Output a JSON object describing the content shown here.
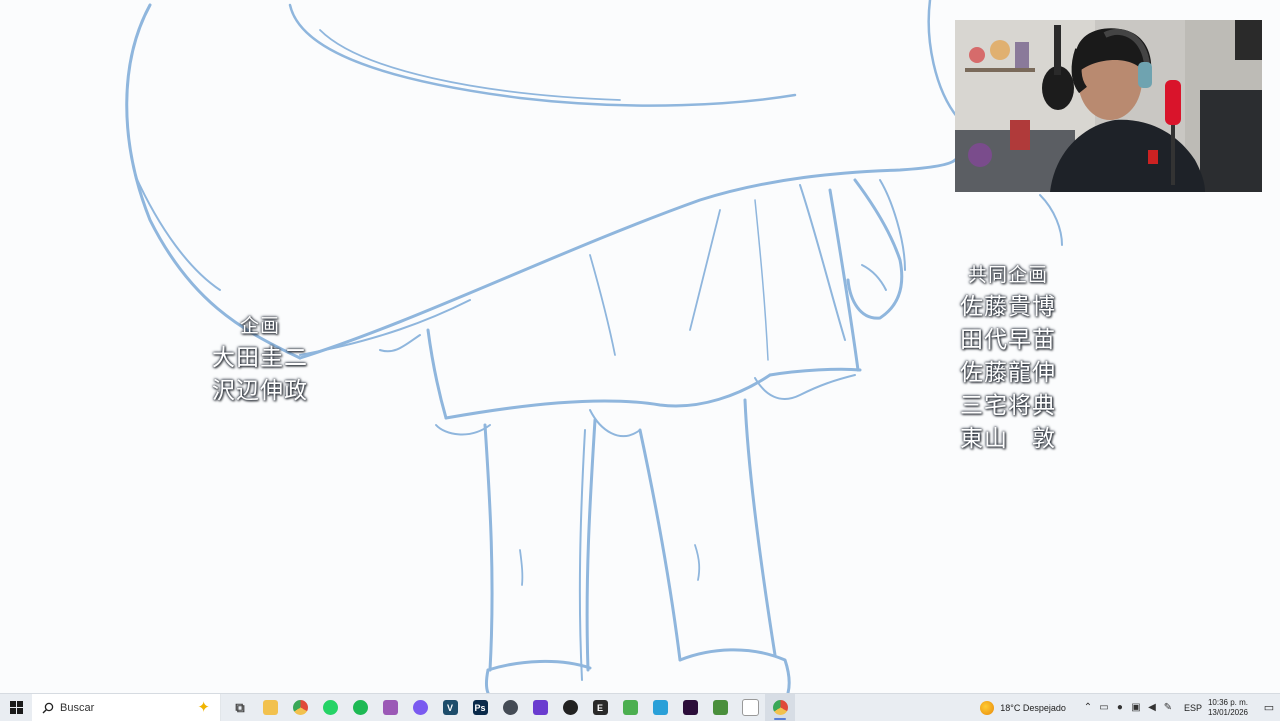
{
  "credits": {
    "left": {
      "heading": "企画",
      "names": [
        "大田圭二",
        "沢辺伸政"
      ]
    },
    "right": {
      "heading": "共同企画",
      "names": [
        "佐藤貴博",
        "田代早苗",
        "佐藤龍伸",
        "三宅将典",
        "東山　敦"
      ]
    }
  },
  "colors": {
    "sketch_line": "#8fb6dd",
    "background": "#fbfcfd",
    "taskbar": "#e9edf2"
  },
  "taskbar": {
    "search_placeholder": "Buscar",
    "apps": [
      {
        "name": "task-view-icon",
        "glyph": "⧉",
        "color": "#444444"
      },
      {
        "name": "file-explorer-icon",
        "glyph": "",
        "color": "#f2c14e"
      },
      {
        "name": "chrome-icon",
        "glyph": "",
        "color": "#e04a3a"
      },
      {
        "name": "whatsapp-icon",
        "glyph": "",
        "color": "#25d366"
      },
      {
        "name": "spotify-icon",
        "glyph": "",
        "color": "#1db954"
      },
      {
        "name": "snipping-tool-icon",
        "glyph": "",
        "color": "#9b59b6"
      },
      {
        "name": "discord-icon",
        "glyph": "",
        "color": "#7a5af0"
      },
      {
        "name": "vegas-icon",
        "glyph": "V",
        "color": "#1e4d6b"
      },
      {
        "name": "photoshop-icon",
        "glyph": "Ps",
        "color": "#0a2a4a"
      },
      {
        "name": "steam-icon",
        "glyph": "",
        "color": "#444b55"
      },
      {
        "name": "firefox-icon",
        "glyph": "",
        "color": "#6a3ccf"
      },
      {
        "name": "obs-icon",
        "glyph": "",
        "color": "#222222"
      },
      {
        "name": "epic-games-icon",
        "glyph": "E",
        "color": "#2a2a2a"
      },
      {
        "name": "minecraft-icon",
        "glyph": "",
        "color": "#4caf50"
      },
      {
        "name": "maps-icon",
        "glyph": "",
        "color": "#2aa0d8"
      },
      {
        "name": "premiere-icon",
        "glyph": "",
        "color": "#2c0e3a"
      },
      {
        "name": "excel-icon",
        "glyph": "",
        "color": "#4a8f3c"
      },
      {
        "name": "notepad-icon",
        "glyph": "",
        "color": "#ffffff"
      },
      {
        "name": "chrome-profile-icon",
        "glyph": "",
        "color": "#e04a3a"
      }
    ],
    "weather": "18°C  Despejado",
    "language": "ESP",
    "time": "10:36 p. m.",
    "date": "13/01/2026"
  }
}
